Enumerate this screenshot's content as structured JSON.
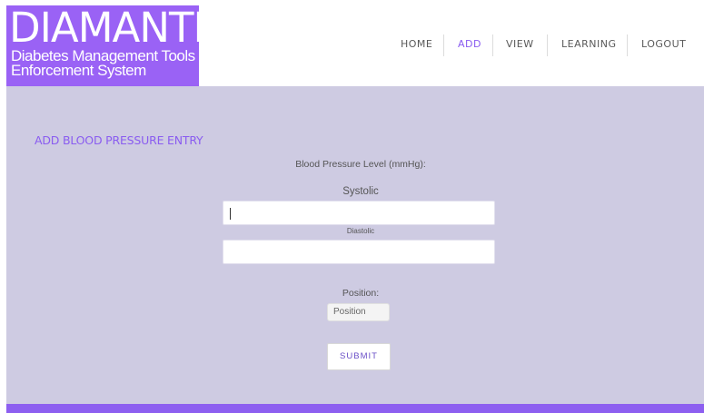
{
  "logo": {
    "title": "DIAMANTES",
    "subtitle_line1": "Diabetes Management Tools",
    "subtitle_line2": "Enforcement System"
  },
  "nav": {
    "items": [
      {
        "label": "HOME",
        "active": false
      },
      {
        "label": "ADD",
        "active": true
      },
      {
        "label": "VIEW",
        "active": false
      },
      {
        "label": "LEARNING",
        "active": false
      },
      {
        "label": "LOGOUT",
        "active": false
      }
    ]
  },
  "form": {
    "title": "ADD BLOOD PRESSURE ENTRY",
    "section_label": "Blood Pressure Level (mmHg):",
    "systolic_label": "Systolic",
    "systolic_value": "",
    "diastolic_label": "Diastolic",
    "diastolic_value": "",
    "position_label": "Position:",
    "position_selected": "Position",
    "submit_label": "SUBMIT"
  },
  "colors": {
    "brand_purple": "#9a62f5",
    "accent_purple": "#8a5cf0",
    "panel_lavender": "#cecbe2"
  }
}
